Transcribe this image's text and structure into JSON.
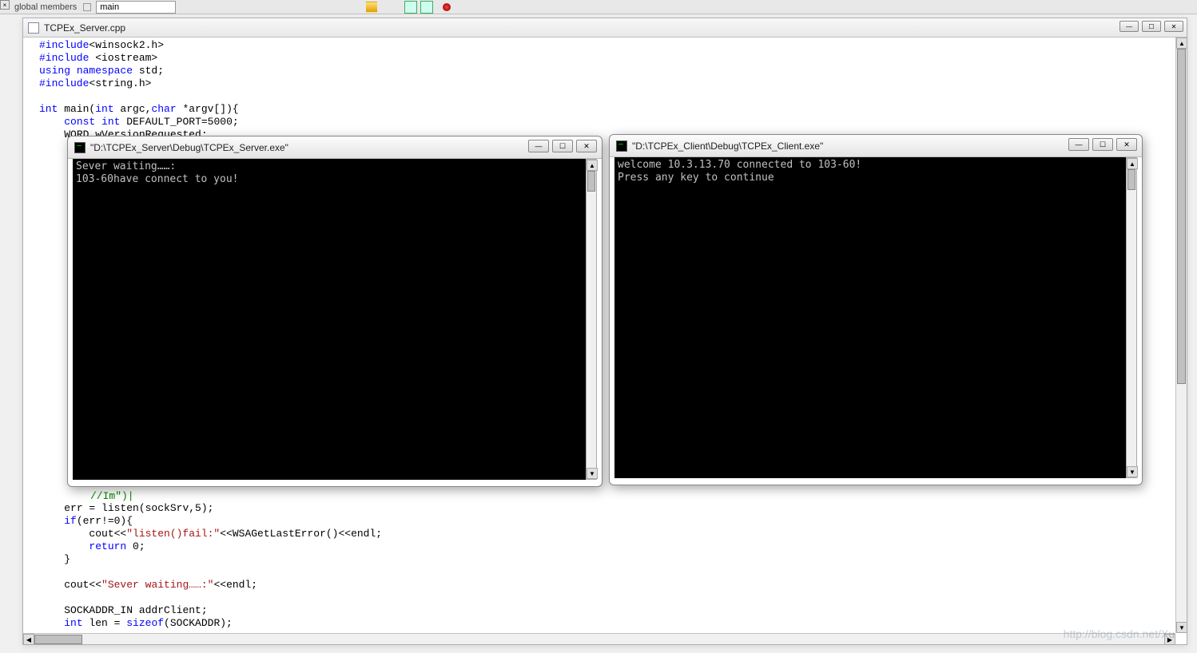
{
  "toolbar": {
    "left_text": "global members",
    "dropdown_value": "main"
  },
  "editor": {
    "tab_title": "TCPEx_Server.cpp"
  },
  "code": {
    "l1_include": "#include",
    "l1_rest": "<winsock2.h>",
    "l2_include": "#include",
    "l2_rest": " <iostream>",
    "l3_using": "using",
    "l3_namespace": " namespace",
    "l3_std": " std;",
    "l4_include": "#include",
    "l4_rest": "<string.h>",
    "l5_int": "int",
    "l5_main": " main(",
    "l5_int2": "int",
    "l5_argc": " argc,",
    "l5_char": "char",
    "l5_argv": " *argv[]){",
    "l6_const": "const",
    "l6_int": " int",
    "l6_rest": " DEFAULT_PORT=5000;",
    "l7": "WORD wVersionRequested;",
    "frag_garbage": "//Im\")|",
    "l8": "err = listen(sockSrv,5);",
    "l9_if": "if",
    "l9_rest": "(err!=0){",
    "l10_cout": "        cout<<",
    "l10_str": "\"listen()fail:\"",
    "l10_rest": "<<WSAGetLastError()<<endl;",
    "l11_return": "return",
    "l11_rest": " 0;",
    "l12": "}",
    "l13_cout": "cout<<",
    "l13_str": "\"Sever waiting……:\"",
    "l13_rest": "<<endl;",
    "l14": "SOCKADDR_IN addrClient;",
    "l15_int": "int",
    "l15_len": " len = ",
    "l15_sizeof": "sizeof",
    "l15_rest": "(SOCKADDR);"
  },
  "console1": {
    "title": "\"D:\\TCPEx_Server\\Debug\\TCPEx_Server.exe\"",
    "line1": "Sever waiting……:",
    "line2": "103-60have connect to you!"
  },
  "console2": {
    "title": "\"D:\\TCPEx_Client\\Debug\\TCPEx_Client.exe\"",
    "line1": "welcome 10.3.13.70 connected to 103-60!",
    "line2": "Press any key to continue"
  },
  "watermark": "http://blog.csdn.net/Xu"
}
